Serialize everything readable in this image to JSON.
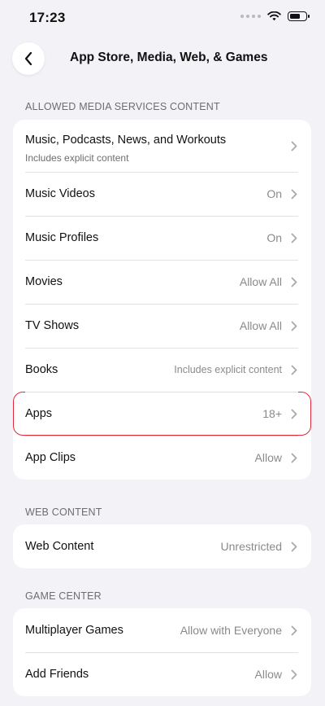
{
  "status_bar": {
    "time": "17:23"
  },
  "header": {
    "title": "App Store, Media, Web, & Games"
  },
  "sections": {
    "media": {
      "header": "ALLOWED MEDIA SERVICES CONTENT",
      "rows": [
        {
          "label": "Music, Podcasts, News, and Workouts",
          "sublabel": "Includes explicit content",
          "value": ""
        },
        {
          "label": "Music Videos",
          "value": "On"
        },
        {
          "label": "Music Profiles",
          "value": "On"
        },
        {
          "label": "Movies",
          "value": "Allow All"
        },
        {
          "label": "TV Shows",
          "value": "Allow All"
        },
        {
          "label": "Books",
          "value": "Includes explicit content"
        },
        {
          "label": "Apps",
          "value": "18+"
        },
        {
          "label": "App Clips",
          "value": "Allow"
        }
      ]
    },
    "web": {
      "header": "WEB CONTENT",
      "rows": [
        {
          "label": "Web Content",
          "value": "Unrestricted"
        }
      ]
    },
    "game_center": {
      "header": "GAME CENTER",
      "rows": [
        {
          "label": "Multiplayer Games",
          "value": "Allow with Everyone"
        },
        {
          "label": "Add Friends",
          "value": "Allow"
        }
      ]
    }
  },
  "icons": {
    "back": "chevron-left-icon",
    "row_disclosure": "chevron-right-icon",
    "wifi": "wifi-icon",
    "battery": "battery-icon",
    "signal": "cellular-signal-icon"
  },
  "colors": {
    "background": "#f2f2f7",
    "card": "#ffffff",
    "highlight_outline": "#e0293a",
    "secondary_text": "#8a8a8e"
  }
}
